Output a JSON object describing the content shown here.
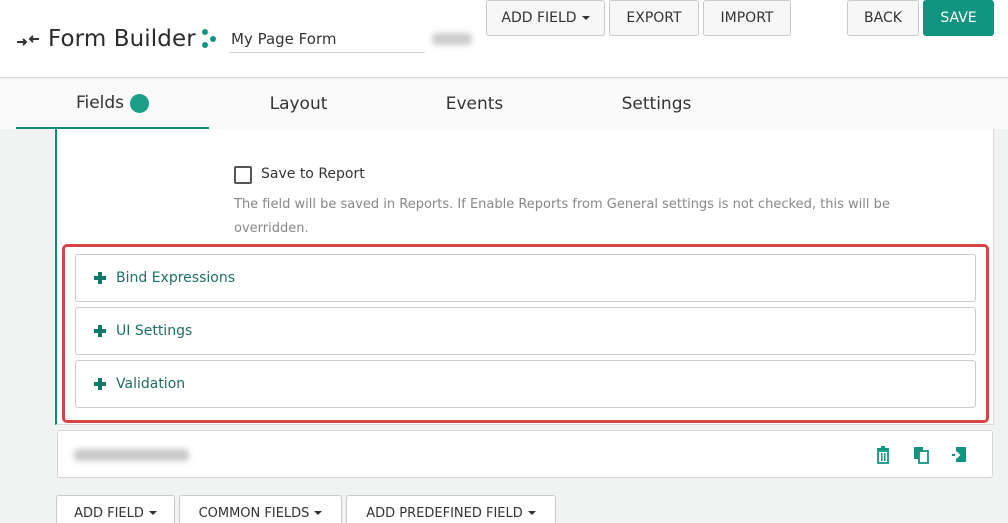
{
  "header": {
    "title": "Form Builder",
    "form_name": "My Page Form",
    "buttons": {
      "add_field": "ADD FIELD",
      "export": "EXPORT",
      "import": "IMPORT",
      "back": "BACK",
      "save": "SAVE"
    },
    "icons": [
      "collapse-toggle-icon",
      "share-nodes-icon"
    ]
  },
  "tabs": [
    {
      "label": "Fields",
      "active": true
    },
    {
      "label": "Layout",
      "active": false
    },
    {
      "label": "Events",
      "active": false
    },
    {
      "label": "Settings",
      "active": false
    }
  ],
  "field_settings": {
    "save_to_report": {
      "label": "Save to Report",
      "checked": false,
      "help": "The field will be saved in Reports. If Enable Reports from General settings is not checked, this will be overridden."
    },
    "sections": [
      {
        "label": "Bind Expressions",
        "icon": "plus-icon"
      },
      {
        "label": "UI Settings",
        "icon": "plus-icon"
      },
      {
        "label": "Validation",
        "icon": "plus-icon"
      }
    ]
  },
  "field_row": {
    "actions": [
      "trash-icon",
      "copy-icon",
      "move-icon"
    ]
  },
  "bottom_bar": {
    "add_field": "ADD FIELD",
    "common_fields": "COMMON FIELDS",
    "add_predefined_field": "ADD PREDEFINED FIELD"
  },
  "colors": {
    "accent": "#129580",
    "highlight": "#d64545"
  }
}
